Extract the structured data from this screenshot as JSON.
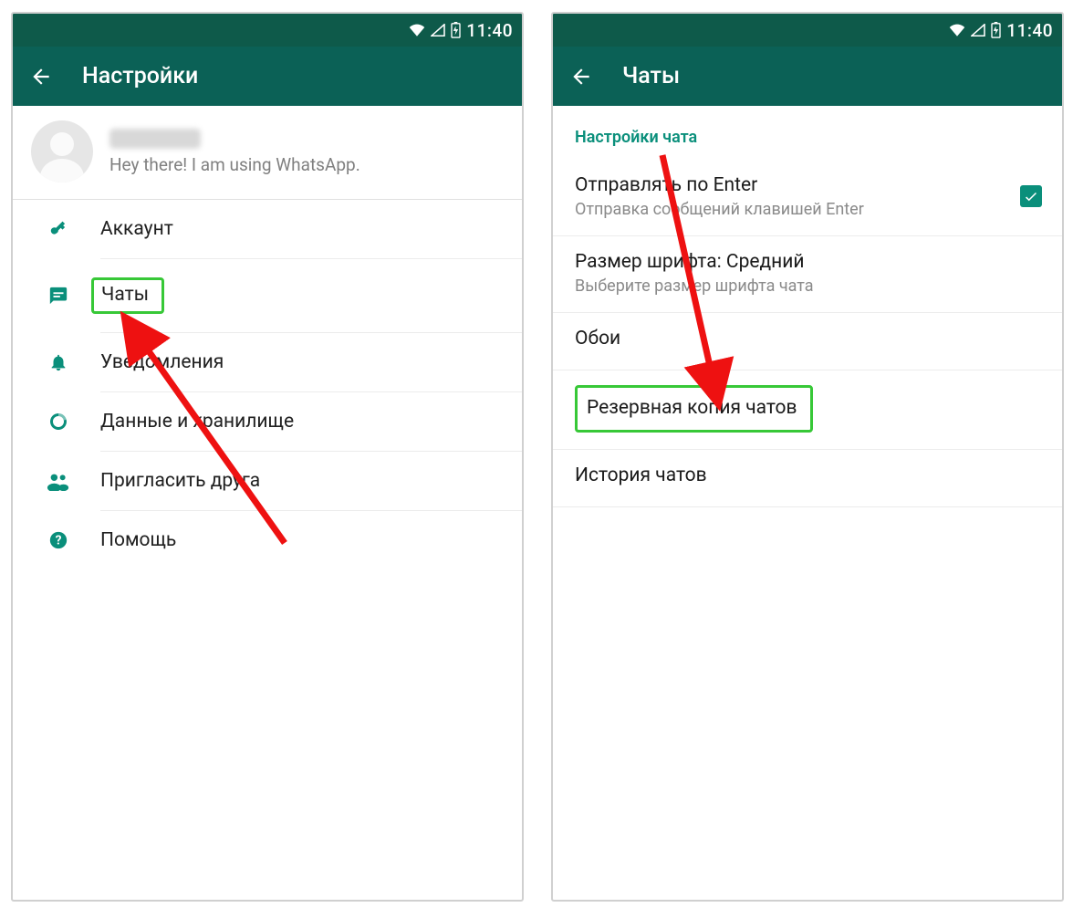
{
  "status_bar": {
    "time": "11:40"
  },
  "left_screen": {
    "title": "Настройки",
    "profile_status": "Hey there! I am using WhatsApp.",
    "menu": {
      "account": "Аккаунт",
      "chats": "Чаты",
      "notifications": "Уведомления",
      "data": "Данные и хранилище",
      "invite": "Пригласить друга",
      "help": "Помощь"
    }
  },
  "right_screen": {
    "title": "Чаты",
    "section_header": "Настройки чата",
    "enter_send": {
      "title": "Отправлять по Enter",
      "sub": "Отправка сообщений клавишей Enter",
      "checked": true
    },
    "font_size": {
      "title": "Размер шрифта: Средний",
      "sub": "Выберите размер шрифта чата"
    },
    "wallpaper": "Обои",
    "backup": "Резервная копия чатов",
    "history": "История чатов"
  }
}
